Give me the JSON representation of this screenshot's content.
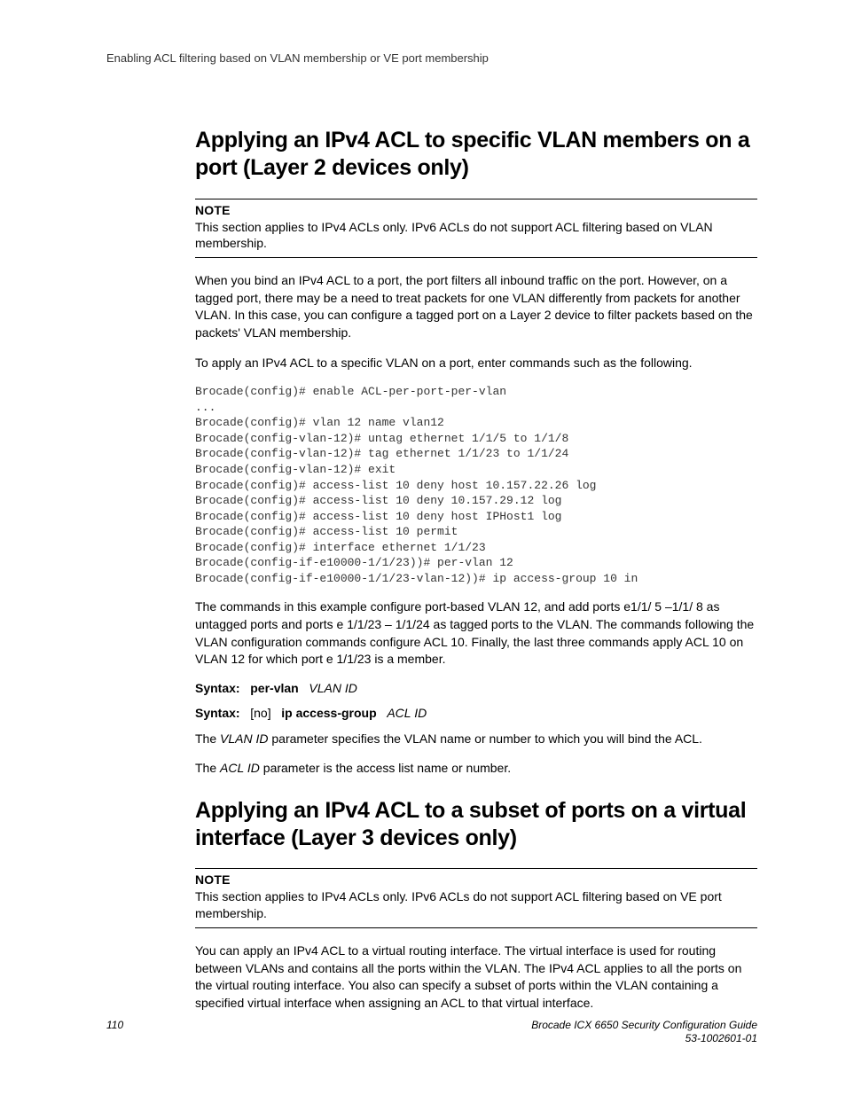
{
  "header": {
    "running": "Enabling ACL filtering based on VLAN membership or VE port membership"
  },
  "section1": {
    "heading": "Applying an IPv4 ACL to specific VLAN members on a port (Layer 2 devices only)",
    "note_label": "NOTE",
    "note_text": "This section applies to IPv4 ACLs only. IPv6 ACLs do not support ACL filtering based on VLAN membership.",
    "p1": "When you bind an IPv4 ACL to a port, the port filters all inbound traffic on the port. However, on a tagged port, there may be a need to treat packets for one VLAN differently from packets for another VLAN. In this case, you can configure a tagged port on a Layer 2 device to filter packets based on the packets' VLAN membership.",
    "p2": "To apply an IPv4 ACL to a specific VLAN on a port, enter commands such as the following.",
    "code": "Brocade(config)# enable ACL-per-port-per-vlan\n...\nBrocade(config)# vlan 12 name vlan12\nBrocade(config-vlan-12)# untag ethernet 1/1/5 to 1/1/8\nBrocade(config-vlan-12)# tag ethernet 1/1/23 to 1/1/24\nBrocade(config-vlan-12)# exit\nBrocade(config)# access-list 10 deny host 10.157.22.26 log\nBrocade(config)# access-list 10 deny 10.157.29.12 log\nBrocade(config)# access-list 10 deny host IPHost1 log\nBrocade(config)# access-list 10 permit\nBrocade(config)# interface ethernet 1/1/23\nBrocade(config-if-e10000-1/1/23))# per-vlan 12\nBrocade(config-if-e10000-1/1/23-vlan-12))# ip access-group 10 in",
    "p3": "The commands in this example configure port-based VLAN 12, and add ports e1/1/ 5 –1/1/ 8 as untagged ports and ports e 1/1/23 – 1/1/24 as tagged ports to the VLAN. The commands following the VLAN configuration commands configure ACL 10. Finally, the last three commands apply ACL 10 on VLAN 12 for which port e 1/1/23 is a member.",
    "syntax1_lbl": "Syntax:",
    "syntax1_kw": "per-vlan",
    "syntax1_var": "VLAN ID",
    "syntax2_lbl": "Syntax:",
    "syntax2_opt": "[no]",
    "syntax2_kw": "ip access-group",
    "syntax2_var": "ACL ID",
    "p4_pre": "The ",
    "p4_var": "VLAN ID",
    "p4_post": " parameter specifies the VLAN name or number to which you will bind the ACL.",
    "p5_pre": "The ",
    "p5_var": "ACL ID",
    "p5_post": " parameter is the access list name or number."
  },
  "section2": {
    "heading": "Applying an IPv4 ACL to a subset of ports on a virtual interface (Layer 3 devices only)",
    "note_label": "NOTE",
    "note_text": "This section applies to IPv4 ACLs only. IPv6 ACLs do not support ACL filtering based on VE port membership.",
    "p1": "You can apply an IPv4 ACL to a virtual routing interface. The virtual interface is used for routing between VLANs and contains all the ports within the VLAN. The IPv4 ACL applies to all the ports on the virtual routing interface. You also can specify a subset of ports within the VLAN containing a specified virtual interface when assigning an ACL to that virtual interface."
  },
  "footer": {
    "page": "110",
    "title": "Brocade ICX 6650 Security Configuration Guide",
    "docnum": "53-1002601-01"
  }
}
